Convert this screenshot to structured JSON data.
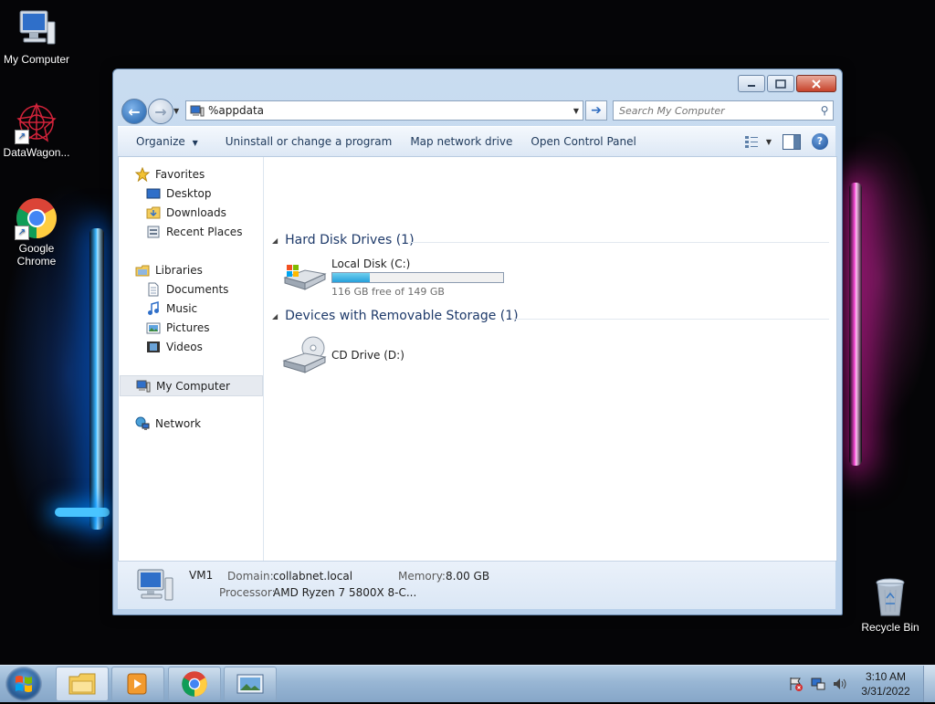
{
  "desktop": {
    "icons": [
      {
        "label": "My Computer"
      },
      {
        "label": "DataWagon..."
      },
      {
        "label": "Google Chrome"
      },
      {
        "label": "Recycle Bin"
      }
    ]
  },
  "window": {
    "address": "%appdata",
    "search_placeholder": "Search My Computer",
    "commands": [
      "Organize",
      "Uninstall or change a program",
      "Map network drive",
      "Open Control Panel"
    ],
    "nav": {
      "favorites": "Favorites",
      "desktop": "Desktop",
      "downloads": "Downloads",
      "recent": "Recent Places",
      "libraries": "Libraries",
      "documents": "Documents",
      "music": "Music",
      "pictures": "Pictures",
      "videos": "Videos",
      "my_computer": "My Computer",
      "network": "Network"
    },
    "groups": {
      "hdd": "Hard Disk Drives (1)",
      "removable": "Devices with Removable Storage (1)"
    },
    "drives": {
      "c_name": "Local Disk (C:)",
      "c_free": "116 GB free of 149 GB",
      "c_used_fraction": 0.22,
      "d_name": "CD Drive (D:)"
    },
    "details": {
      "name": "VM1",
      "domain_label": "Domain:",
      "domain_value": "collabnet.local",
      "memory_label": "Memory:",
      "memory_value": "8.00 GB",
      "processor_label": "Processor:",
      "processor_value": "AMD Ryzen 7 5800X 8-C..."
    }
  },
  "taskbar": {
    "time": "3:10 AM",
    "date": "3/31/2022"
  }
}
